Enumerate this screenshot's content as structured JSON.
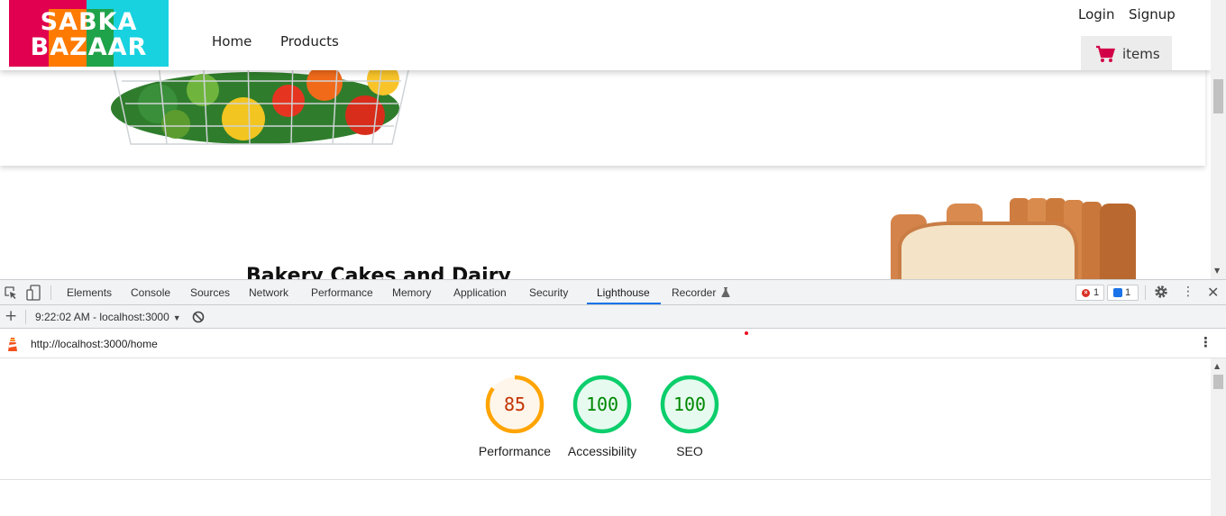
{
  "site": {
    "logo_line1": "SABKA",
    "logo_line2": "BAZAAR",
    "nav": {
      "home": "Home",
      "products": "Products"
    },
    "auth": {
      "login": "Login",
      "signup": "Signup"
    },
    "cart": {
      "label": "items",
      "icon": "cart-icon"
    },
    "bakery_title": "Bakery Cakes and Dairy"
  },
  "devtools": {
    "tabs": [
      "Elements",
      "Console",
      "Sources",
      "Network",
      "Performance",
      "Memory",
      "Application",
      "Security",
      "Lighthouse",
      "Recorder"
    ],
    "active_tab": "Lighthouse",
    "error_count": "1",
    "message_count": "1",
    "report_select": "9:22:02 AM - localhost:3000",
    "report_url": "http://localhost:3000/home"
  },
  "lighthouse": {
    "scores": [
      {
        "label": "Performance",
        "score": "85",
        "value": 85,
        "color": "#ffa400",
        "text_color": "#c33300",
        "bg": "#fff6eb"
      },
      {
        "label": "Accessibility",
        "score": "100",
        "value": 100,
        "color": "#0cce6b",
        "text_color": "#008800",
        "bg": "#e6faf0"
      },
      {
        "label": "SEO",
        "score": "100",
        "value": 100,
        "color": "#0cce6b",
        "text_color": "#008800",
        "bg": "#e6faf0"
      }
    ]
  },
  "colors": {
    "accent": "#1a73e8",
    "brand_pink": "#e0004f",
    "cart_icon": "#d10047"
  }
}
